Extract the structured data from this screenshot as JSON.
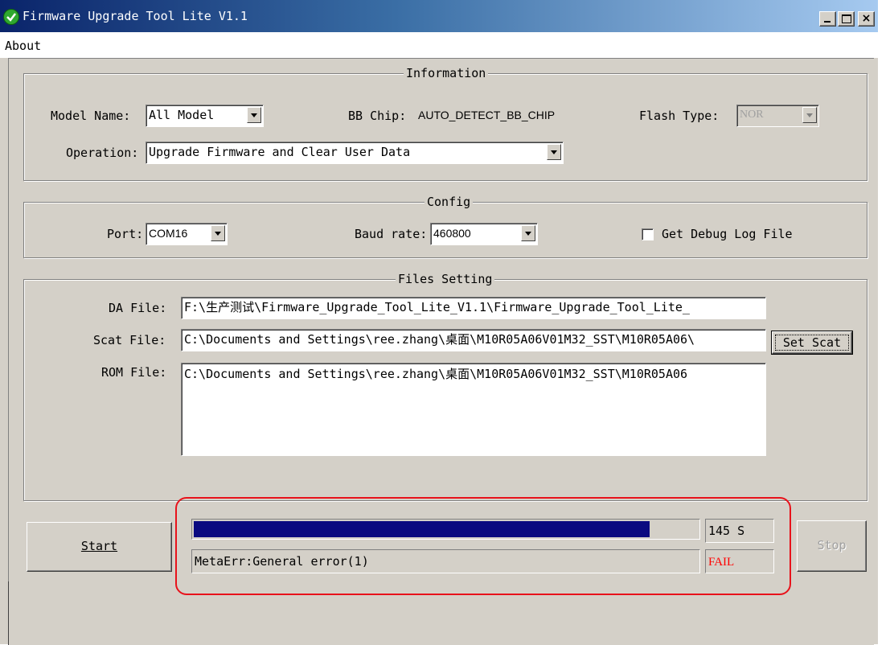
{
  "window": {
    "title": "Firmware Upgrade Tool Lite V1.1",
    "title_icon": "checkmark-icon",
    "controls": [
      "minimize",
      "maximize",
      "close"
    ],
    "close_glyph": "×"
  },
  "menu": {
    "about": "About"
  },
  "information": {
    "title": "Information",
    "model_label": "Model Name:",
    "model_value": "All Model",
    "chip_label": "BB Chip:",
    "chip_value": "AUTO_DETECT_BB_CHIP",
    "flash_label": "Flash Type:",
    "flash_value": "NOR",
    "operation_label": "Operation:",
    "operation_value": "Upgrade Firmware and Clear User Data"
  },
  "config": {
    "title": "Config",
    "port_label": "Port:",
    "port_value": "COM16",
    "baud_label": "Baud rate:",
    "baud_value": "460800",
    "debug_log_label": "Get Debug Log File",
    "debug_log_checked": false
  },
  "files": {
    "title": "Files Setting",
    "da_label": "DA File:",
    "da_value": "F:\\生产测试\\Firmware_Upgrade_Tool_Lite_V1.1\\Firmware_Upgrade_Tool_Lite_",
    "scat_label": "Scat File:",
    "scat_value": "C:\\Documents and Settings\\ree.zhang\\桌面\\M10R05A06V01M32_SST\\M10R05A06\\",
    "set_scat_label": "Set Scat",
    "rom_label": "ROM File:",
    "rom_value": "C:\\Documents and Settings\\ree.zhang\\桌面\\M10R05A06V01M32_SST\\M10R05A06"
  },
  "progress": {
    "start_label": "Start",
    "stop_label": "Stop",
    "elapsed": "145 S",
    "fill_fraction": 0.905,
    "message": "MetaErr:General error(1)",
    "result": "FAIL",
    "result_color": "#ff0000",
    "bar_color": "#0a0a80",
    "highlight_color": "#e8121b"
  }
}
